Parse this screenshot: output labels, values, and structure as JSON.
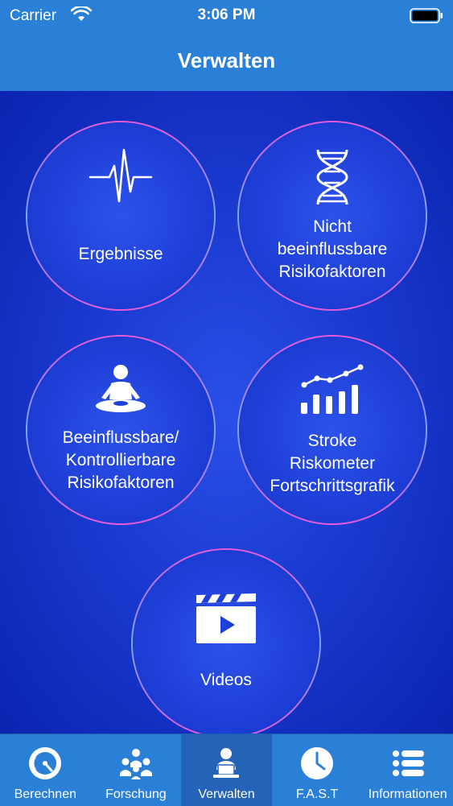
{
  "status": {
    "carrier": "Carrier",
    "time": "3:06 PM"
  },
  "header": {
    "title": "Verwalten"
  },
  "tiles": {
    "ergebnisse": {
      "icon": "heartbeat-icon",
      "lines": [
        "Ergebnisse"
      ]
    },
    "nicht": {
      "icon": "dna-icon",
      "lines": [
        "Nicht",
        "beeinflussbare",
        "Risikofaktoren"
      ]
    },
    "beeinfluss": {
      "icon": "meditation-icon",
      "lines": [
        "Beeinflussbare/",
        "Kontrollierbare",
        "Risikofaktoren"
      ]
    },
    "stroke": {
      "icon": "bar-chart-icon",
      "lines": [
        "Stroke",
        "Riskometer",
        "Fortschrittsgrafik"
      ]
    },
    "videos": {
      "icon": "clapperboard-icon",
      "lines": [
        "Videos"
      ]
    }
  },
  "tabs": {
    "berechnen": {
      "label": "Berechnen",
      "icon": "gauge-icon"
    },
    "forschung": {
      "label": "Forschung",
      "icon": "group-icon"
    },
    "verwalten": {
      "label": "Verwalten",
      "icon": "user-laptop-icon",
      "active": true
    },
    "fast": {
      "label": "F.A.S.T",
      "icon": "clock-icon"
    },
    "informationen": {
      "label": "Informationen",
      "icon": "list-icon"
    }
  },
  "colors": {
    "bar": "#2a7fd6",
    "background": "#1a3ad0",
    "ring": "#e85ad8",
    "active_tab": "#2463b8"
  }
}
